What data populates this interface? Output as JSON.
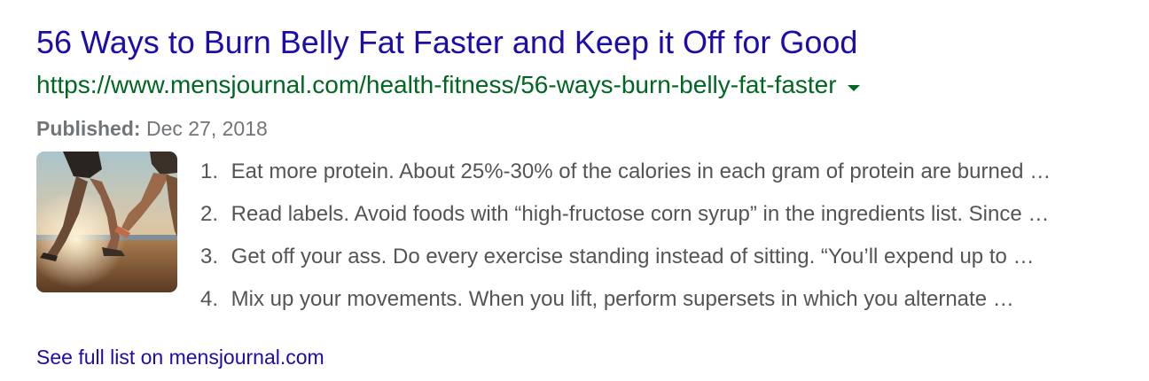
{
  "result": {
    "title": "56 Ways to Burn Belly Fat Faster and Keep it Off for Good",
    "url": "https://www.mensjournal.com/health-fitness/56-ways-burn-belly-fat-faster",
    "published_label": "Published:",
    "published_date": "Dec 27, 2018",
    "thumbnail_icon": "runners-on-beach-image",
    "list": [
      {
        "num": "1.",
        "text": "Eat more protein. About 25%-30% of the calories in each gram of protein are burned …"
      },
      {
        "num": "2.",
        "text": "Read labels. Avoid foods with “high-fructose corn syrup” in the ingredients list. Since …"
      },
      {
        "num": "3.",
        "text": "Get off your ass. Do every exercise standing instead of sitting. “You’ll expend up to …"
      },
      {
        "num": "4.",
        "text": "Mix up your movements. When you lift, perform supersets in which you alternate …"
      }
    ],
    "more_link": "See full list on mensjournal.com"
  },
  "colors": {
    "title": "#1a0dab",
    "url": "#006621",
    "snippet": "#545454",
    "meta": "#70757a"
  }
}
